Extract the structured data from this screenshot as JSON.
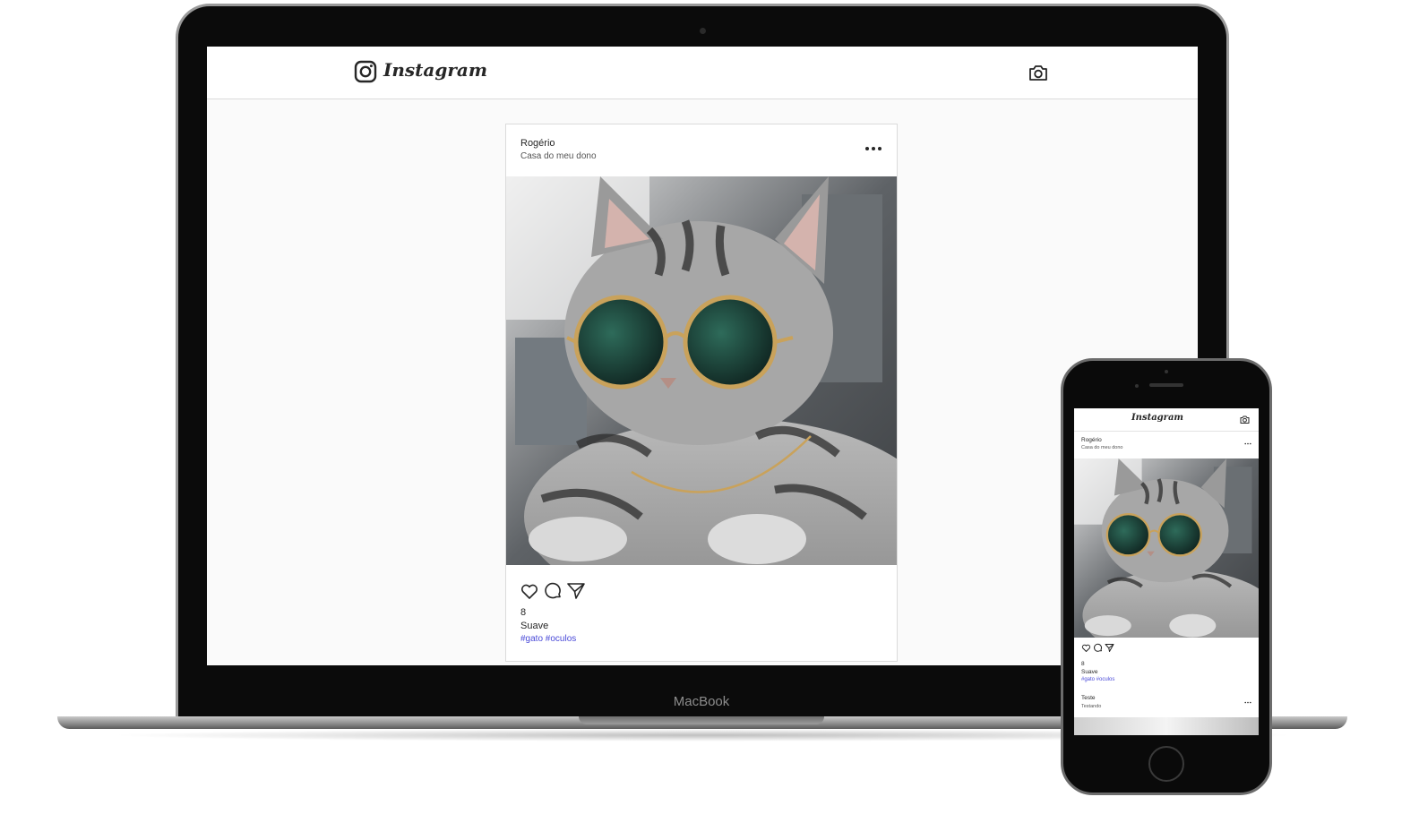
{
  "device_labels": {
    "laptop_brand": "MacBook"
  },
  "desktop": {
    "header": {
      "logo_text": "Instagram",
      "logo_icon": "instagram-glyph-icon",
      "camera_icon": "camera-icon"
    },
    "post": {
      "username": "Rogério",
      "location": "Casa do meu dono",
      "more_icon": "more-options-icon",
      "photo_subject": "cat-with-sunglasses-photo",
      "actions": [
        "heart-icon",
        "comment-icon",
        "share-icon"
      ],
      "likes": "8",
      "caption": "Suave",
      "hashtags": "#gato #oculos"
    }
  },
  "mobile": {
    "header": {
      "logo_text": "Instagram",
      "camera_icon": "camera-icon"
    },
    "posts": [
      {
        "username": "Rogério",
        "location": "Casa do meu dono",
        "likes": "8",
        "caption": "Suave",
        "hashtags": "#gato #oculos"
      },
      {
        "username": "Teste",
        "location": "Testando"
      }
    ]
  },
  "colors": {
    "hashtag": "#4a4ad8",
    "border": "#dbdbdb",
    "feed_background": "#fafafa",
    "device_body": "#0b0b0b"
  }
}
